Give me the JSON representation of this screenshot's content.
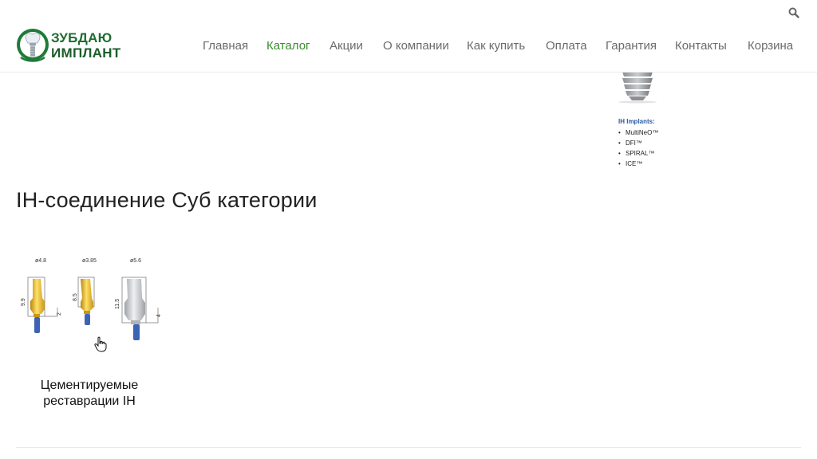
{
  "header": {
    "logo": {
      "line1": "ЗУБДАЮ",
      "line2": "ИМПЛАНТ"
    },
    "nav": [
      {
        "label": "Главная",
        "active": false
      },
      {
        "label": "Каталог",
        "active": true
      },
      {
        "label": "Акции",
        "active": false
      },
      {
        "label": "О компании",
        "active": false
      },
      {
        "label": "Как купить",
        "active": false
      },
      {
        "label": "Оплата",
        "active": false
      },
      {
        "label": "Гарантия",
        "active": false
      },
      {
        "label": "Контакты",
        "active": false
      },
      {
        "label": "Корзина",
        "active": false
      }
    ]
  },
  "implants": {
    "title": "IH Implants:",
    "items": [
      "MultiNeO™",
      "DFI™",
      "SPIRAL™",
      "ICE™"
    ]
  },
  "page": {
    "title": "IH-соединение Суб категории"
  },
  "product": {
    "image_labels": {
      "d1": "ø4.8",
      "d2": "ø3.85",
      "d3": "ø5.6",
      "h1": "9.9",
      "g1": "2",
      "h2": "8.5",
      "h3": "11.5",
      "g3": "4"
    },
    "name_line1": "Цементируемые",
    "name_line2": "реставрации IH"
  },
  "colors": {
    "accent": "#3a8e2e",
    "nav": "#6b6b6b",
    "logo": "#1d6d2f"
  },
  "icons": [
    "search-icon",
    "tooth-logo-icon",
    "hand-cursor-icon"
  ]
}
